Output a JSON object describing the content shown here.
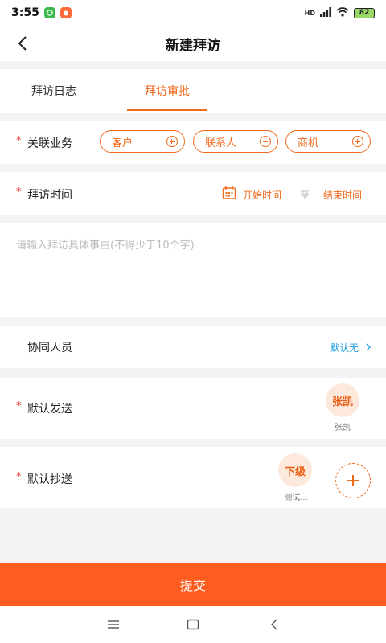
{
  "status_bar": {
    "time": "3:55",
    "battery": "82",
    "network": "HD"
  },
  "header": {
    "title": "新建拜访"
  },
  "tabs": [
    {
      "label": "拜访日志",
      "active": false
    },
    {
      "label": "拜访审批",
      "active": true
    }
  ],
  "related_business": {
    "label": "关联业务",
    "required": "*",
    "chips": [
      "客户",
      "联系人",
      "商机"
    ]
  },
  "visit_time": {
    "label": "拜访时间",
    "required": "*",
    "start": "开始时间",
    "separator": "至",
    "end": "结束时间"
  },
  "reason": {
    "placeholder": "请输入拜访具体事由(不得少于10个字)"
  },
  "collaborators": {
    "label": "协同人员",
    "value": "默认无"
  },
  "default_send": {
    "label": "默认发送",
    "required": "*",
    "avatar_text": "张凯",
    "caption": "张凯"
  },
  "default_cc": {
    "label": "默认抄送",
    "required": "*",
    "avatar_text": "下级",
    "caption": "测试..."
  },
  "submit": {
    "label": "提交"
  },
  "colors": {
    "accent": "#f26a1b",
    "submit": "#ff5c1f",
    "link": "#1ea0e0",
    "required": "#e5322d"
  }
}
